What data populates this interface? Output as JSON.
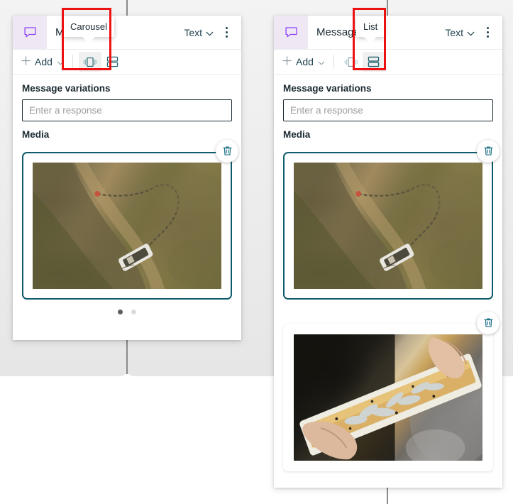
{
  "canvas": {
    "background_top": "#eeeeee",
    "background_bottom": "#ffffff",
    "connector_color": "#8a8a8a"
  },
  "theme": {
    "accent_teal": "#0f5b6b",
    "node_icon_bg": "#efe7f3",
    "node_icon_color": "#8a3ffc",
    "text_primary": "#1b2a32",
    "annotation_red": "#ee1111",
    "placeholder_gray": "#9e9e9e"
  },
  "panels": [
    {
      "id": "carousel-panel",
      "header": {
        "node_icon": "message-bubble-icon",
        "title": "Message",
        "format_dropdown": "Text",
        "chevron_icon": "chevron-down-icon",
        "overflow_icon": "kebab-menu-icon"
      },
      "toolbar": {
        "add_label": "Add",
        "add_icon": "plus-icon",
        "add_chevron": "chevron-down-icon",
        "carousel_icon": "carousel-layout-icon",
        "list_icon": "list-layout-icon",
        "selected_layout": "carousel"
      },
      "body": {
        "variations_label": "Message variations",
        "response_placeholder": "Enter a response",
        "response_value": "",
        "media_label": "Media"
      },
      "media_cards": [
        {
          "selected": true,
          "image_alt": "aerial-view-of-fishing-boat-with-net-in-shallow-water",
          "delete_icon": "trash-icon",
          "style": "aerial"
        }
      ],
      "pagination": {
        "dots": 2,
        "active_index": 0
      },
      "tooltip": {
        "label": "Carousel",
        "target": "carousel-layout-icon"
      },
      "annotation": {
        "shape": "rectangle",
        "color": "#ee1111",
        "around": "carousel-layout-button-and-tooltip"
      }
    },
    {
      "id": "list-panel",
      "header": {
        "node_icon": "message-bubble-icon",
        "title": "Message",
        "format_dropdown": "Text",
        "chevron_icon": "chevron-down-icon",
        "overflow_icon": "kebab-menu-icon"
      },
      "toolbar": {
        "add_label": "Add",
        "add_icon": "plus-icon",
        "add_chevron": "chevron-down-icon",
        "carousel_icon": "carousel-layout-icon",
        "list_icon": "list-layout-icon",
        "selected_layout": "list"
      },
      "body": {
        "variations_label": "Message variations",
        "response_placeholder": "Enter a response",
        "response_value": "",
        "media_label": "Media"
      },
      "media_cards": [
        {
          "selected": true,
          "image_alt": "aerial-view-of-fishing-boat-with-net-in-shallow-water",
          "delete_icon": "trash-icon",
          "style": "aerial"
        },
        {
          "selected": false,
          "image_alt": "hands-holding-tray-of-small-silver-fish",
          "delete_icon": "trash-icon",
          "style": "fish"
        }
      ],
      "pagination": null,
      "tooltip": {
        "label": "List",
        "target": "list-layout-icon"
      },
      "annotation": {
        "shape": "rectangle",
        "color": "#ee1111",
        "around": "list-layout-button-and-tooltip"
      }
    }
  ]
}
